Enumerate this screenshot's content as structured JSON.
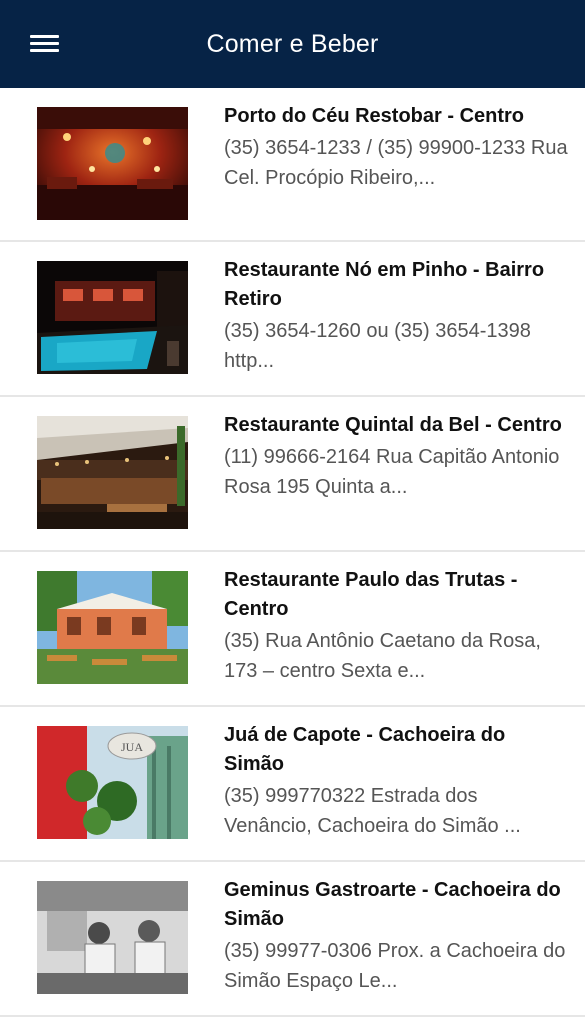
{
  "header": {
    "title": "Comer e Beber"
  },
  "items": [
    {
      "name": "Porto do Céu Restobar - Centro",
      "desc": "(35) 3654-1233 / (35) 99900-1233 Rua Cel. Procópio Ribeiro,..."
    },
    {
      "name": "Restaurante Nó em Pinho - Bairro Retiro",
      "desc": "(35) 3654-1260 ou (35) 3654-1398 http..."
    },
    {
      "name": "Restaurante Quintal da Bel - Centro",
      "desc": "(11) 99666-2164 Rua Capitão Antonio Rosa 195 Quinta a..."
    },
    {
      "name": "Restaurante Paulo das Trutas - Centro",
      "desc": "(35) Rua Antônio Caetano da Rosa, 173 – centro Sexta e..."
    },
    {
      "name": "Juá de Capote - Cachoeira do Simão",
      "desc": "(35) 999770322 Estrada dos Venâncio, Cachoeira do Simão ..."
    },
    {
      "name": "Geminus Gastroarte - Cachoeira do Simão",
      "desc": "(35) 99977-0306 Prox. a Cachoeira do Simão Espaço Le..."
    }
  ],
  "thumb_sign_text": "JUA"
}
